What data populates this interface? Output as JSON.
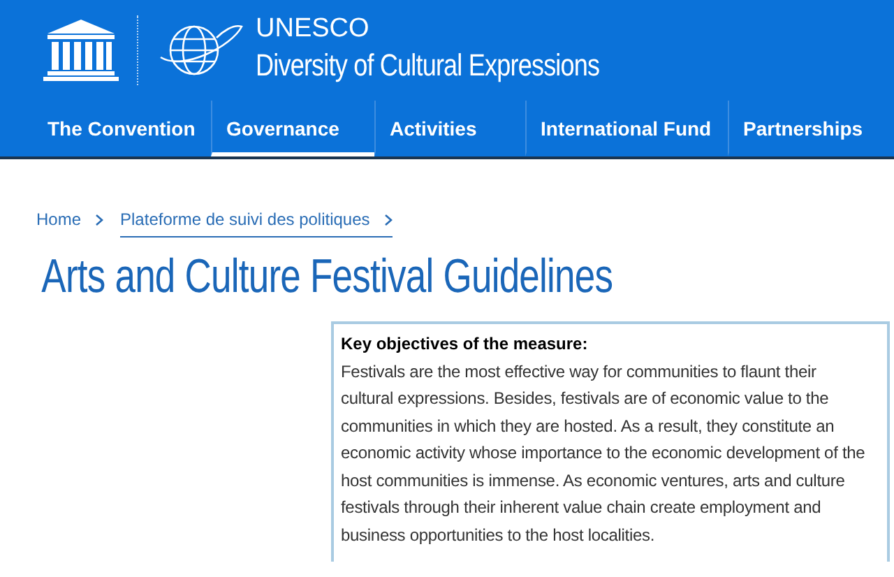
{
  "header": {
    "org": "UNESCO",
    "site_title": "Diversity of Cultural Expressions"
  },
  "nav": [
    {
      "label": "The Convention",
      "selected": false
    },
    {
      "label": "Governance",
      "selected": true
    },
    {
      "label": "Activities",
      "selected": false
    },
    {
      "label": "International Fund",
      "selected": false
    },
    {
      "label": "Partnerships",
      "selected": false
    }
  ],
  "breadcrumb": [
    {
      "label": "Home",
      "underlined": false
    },
    {
      "label": "Plateforme de suivi des politiques",
      "underlined": true
    }
  ],
  "page_title": "Arts and Culture Festival Guidelines",
  "measure_box": {
    "heading": "Key objectives of the measure:",
    "text": "Festivals are the most effective way for communities to flaunt their cultural expressions. Besides, festivals are of economic value to the communities in which they are hosted. As a result, they constitute an economic activity whose importance to the economic development of the host communities is immense. As economic ventures, arts and culture festivals through their inherent value chain create employment and business opportunities to the host localities."
  }
}
